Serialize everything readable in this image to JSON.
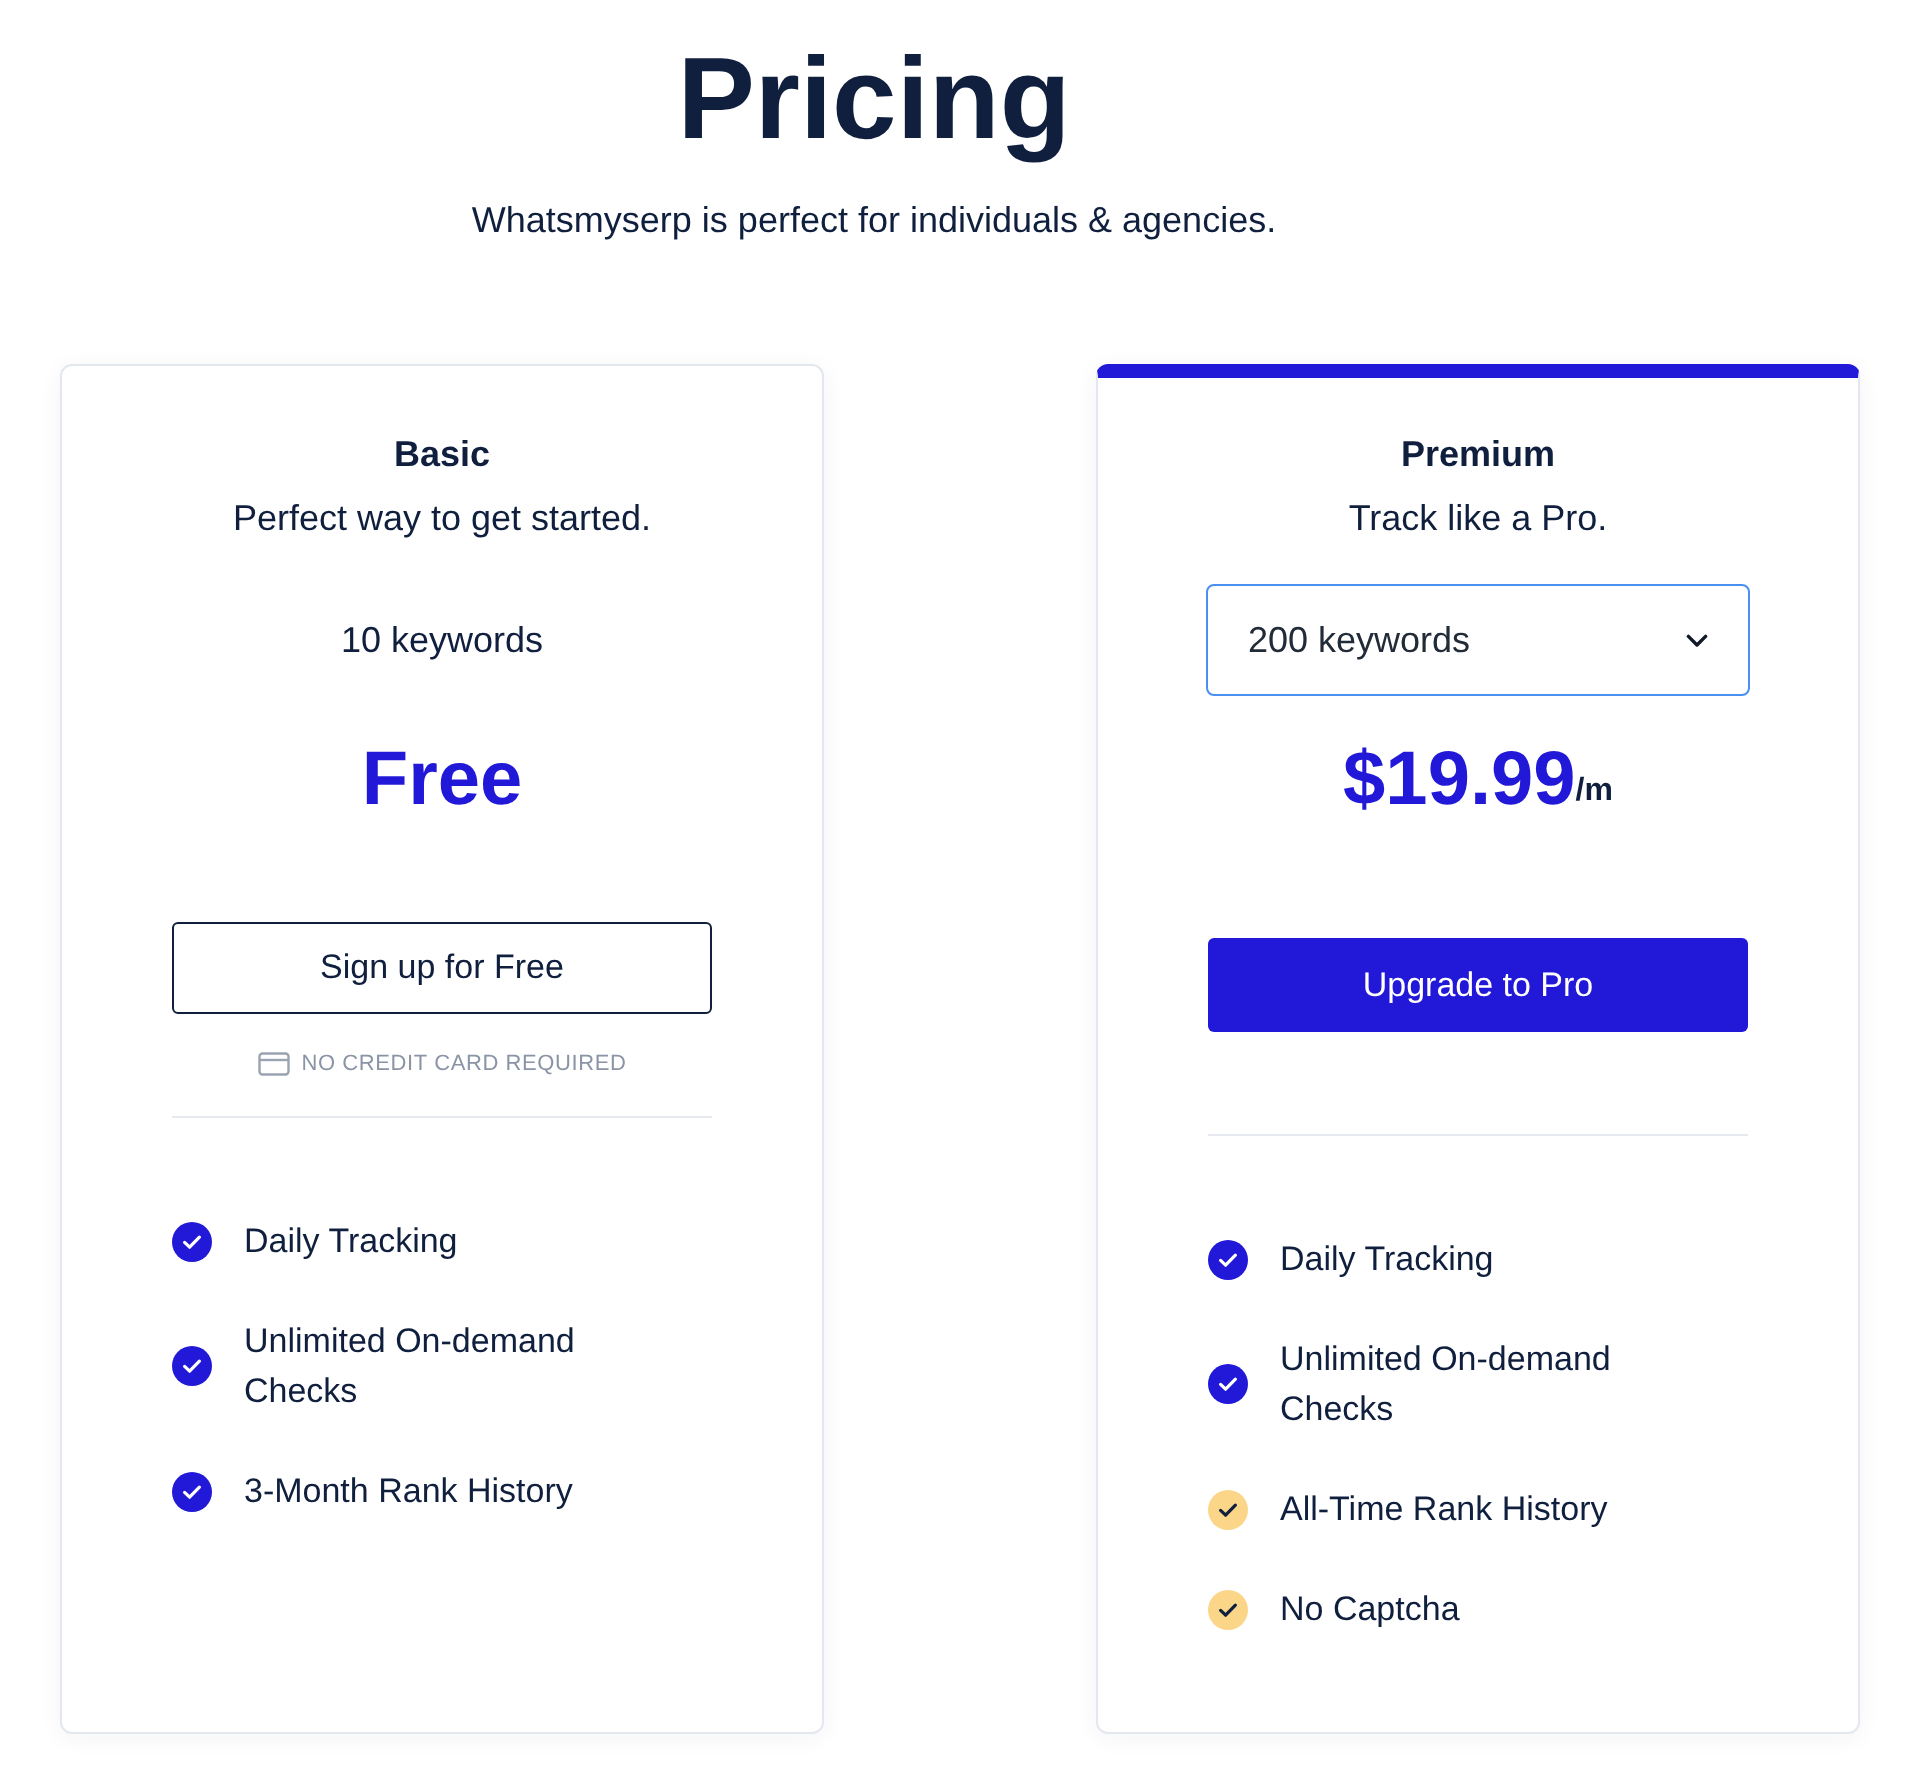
{
  "header": {
    "title": "Pricing",
    "subtitle": "Whatsmyserp is perfect for individuals & agencies."
  },
  "plans": [
    {
      "name": "Basic",
      "tagline": "Perfect way to get started.",
      "highlighted": false,
      "keywords": {
        "kind": "text",
        "value": "10 keywords"
      },
      "price": {
        "amount": "Free"
      },
      "button": {
        "kind": "outline",
        "label": "Sign up for Free"
      },
      "note": "NO CREDIT CARD REQUIRED",
      "features": [
        {
          "label": "Daily Tracking",
          "color": "#2118d8"
        },
        {
          "label": "Unlimited On-demand Checks",
          "color": "#2118d8"
        },
        {
          "label": "3-Month Rank History",
          "color": "#2118d8"
        }
      ]
    },
    {
      "name": "Premium",
      "tagline": "Track like a Pro.",
      "highlighted": true,
      "keywords": {
        "kind": "select",
        "value": "200 keywords"
      },
      "price": {
        "amount": "$19.99",
        "period": "/m"
      },
      "button": {
        "kind": "primary",
        "label": "Upgrade to Pro"
      },
      "features": [
        {
          "label": "Daily Tracking",
          "color": "#2118d8"
        },
        {
          "label": "Unlimited On-demand Checks",
          "color": "#2118d8"
        },
        {
          "label": "All-Time Rank History",
          "color": "#fbd689"
        },
        {
          "label": "No Captcha",
          "color": "#fbd689"
        }
      ]
    }
  ]
}
